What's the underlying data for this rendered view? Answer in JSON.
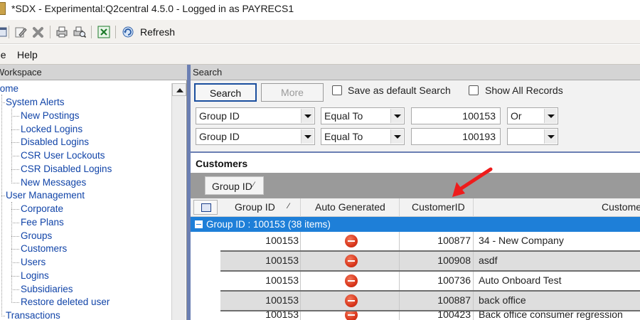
{
  "window": {
    "title": "*SDX - Experimental:Q2central 4.5.0 - Logged in as PAYRECS1"
  },
  "toolbar": {
    "refresh_label": "Refresh",
    "icons": [
      "window-icon",
      "edit-icon",
      "delete-icon",
      "print-icon",
      "print-preview-icon",
      "excel-export-icon",
      "refresh-icon"
    ]
  },
  "menu": {
    "items": [
      "File",
      "Help"
    ]
  },
  "workspace": {
    "header": "Workspace",
    "tree": {
      "home": "Home",
      "system_alerts": {
        "label": "System Alerts",
        "children": [
          "New Postings",
          "Locked Logins",
          "Disabled Logins",
          "CSR User Lockouts",
          "CSR Disabled Logins",
          "New Messages"
        ]
      },
      "user_management": {
        "label": "User Management",
        "children": [
          "Corporate",
          "Fee Plans",
          "Groups",
          "Customers",
          "Users",
          "Logins",
          "Subsidiaries",
          "Restore deleted user"
        ]
      },
      "transactions": "Transactions"
    }
  },
  "search": {
    "header": "Search",
    "search_button": "Search",
    "more_button": "More",
    "save_default_label": "Save as default Search",
    "save_default_checked": false,
    "show_all_label": "Show All Records",
    "show_all_checked": false,
    "criteria": [
      {
        "field": "Group ID",
        "operator": "Equal To",
        "value": "100153",
        "conjunction": "Or"
      },
      {
        "field": "Group ID",
        "operator": "Equal To",
        "value": "100193",
        "conjunction": ""
      }
    ]
  },
  "customers": {
    "title": "Customers",
    "grouped_by": "Group ID",
    "sort_glyph": "⁄",
    "columns": {
      "group_id": "Group ID",
      "auto_generated": "Auto Generated",
      "customer_id": "CustomerID",
      "customer_name": "Customer"
    },
    "group_row": "Group ID : 100153 (38 items)",
    "rows": [
      {
        "group_id": "100153",
        "auto_generated": "no",
        "customer_id": "100877",
        "name": "34 - New Company"
      },
      {
        "group_id": "100153",
        "auto_generated": "no",
        "customer_id": "100908",
        "name": "asdf"
      },
      {
        "group_id": "100153",
        "auto_generated": "no",
        "customer_id": "100736",
        "name": "Auto Onboard Test"
      },
      {
        "group_id": "100153",
        "auto_generated": "no",
        "customer_id": "100887",
        "name": "back office"
      },
      {
        "group_id": "100153",
        "auto_generated": "no",
        "customer_id": "100423",
        "name": "Back office consumer regression"
      }
    ]
  },
  "annotation": {
    "arrow_color": "#ee1c1c"
  }
}
